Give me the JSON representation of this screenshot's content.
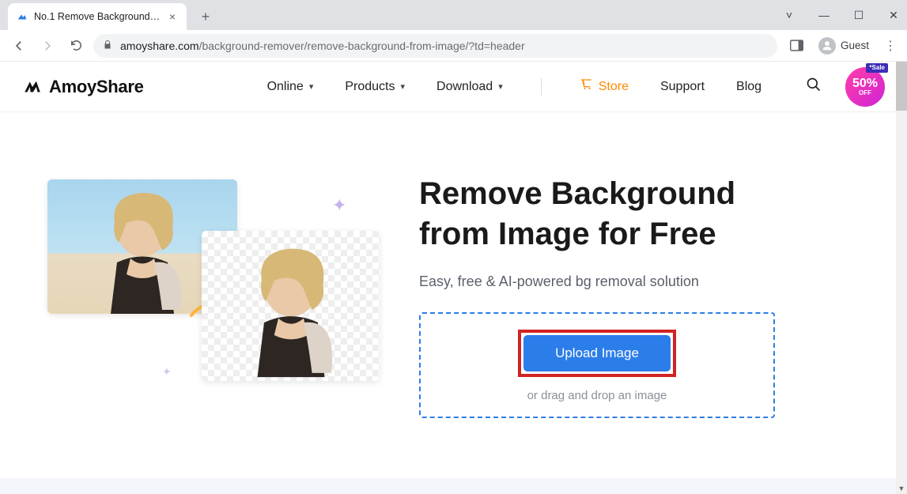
{
  "browser": {
    "tab_title": "No.1 Remove Background from I",
    "url_host": "amoyshare.com",
    "url_path": "/background-remover/remove-background-from-image/?td=header",
    "guest_label": "Guest"
  },
  "header": {
    "brand": "AmoyShare",
    "nav": {
      "online": "Online",
      "products": "Products",
      "download": "Download",
      "store": "Store",
      "support": "Support",
      "blog": "Blog"
    },
    "sale": {
      "tag": "*Sale",
      "pct": "50%",
      "off": "OFF"
    }
  },
  "hero": {
    "title_line1": "Remove Background",
    "title_line2": "from Image for Free",
    "subtitle": "Easy, free & AI-powered bg removal solution",
    "upload_label": "Upload Image",
    "drop_text": "or drag and drop an image"
  }
}
